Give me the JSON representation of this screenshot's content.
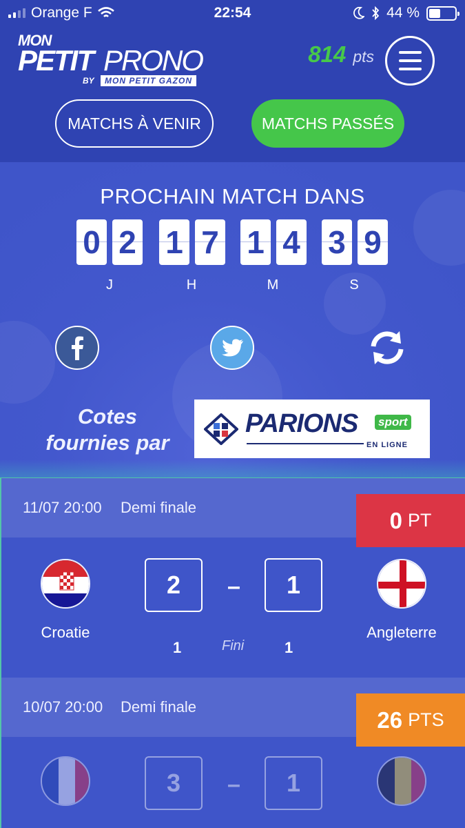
{
  "status_bar": {
    "carrier": "Orange F",
    "time": "22:54",
    "battery": "44 %"
  },
  "header": {
    "logo": {
      "mon": "MON",
      "petit": "PETIT",
      "prono": "PRONO",
      "by": "BY",
      "gazon": "MON PETIT GAZON"
    },
    "points_value": "814",
    "points_unit": "pts",
    "tab_upcoming": "MATCHS À VENIR",
    "tab_past": "MATCHS PASSÉS"
  },
  "countdown": {
    "title": "PROCHAIN MATCH DANS",
    "digits": [
      "0",
      "2",
      "1",
      "7",
      "1",
      "4",
      "3",
      "9"
    ],
    "labels": [
      "J",
      "H",
      "M",
      "S"
    ]
  },
  "sponsor": {
    "text_line1": "Cotes",
    "text_line2": "fournies par",
    "logo_word": "PARIONS",
    "logo_sport": "sport",
    "logo_ligne": "EN LIGNE"
  },
  "matches": [
    {
      "date": "11/07 20:00",
      "round": "Demi finale",
      "points_value": "0",
      "points_unit": "PT",
      "badge_color": "#dc3545",
      "home": "Croatie",
      "away": "Angleterre",
      "home_score": "2",
      "away_score": "1",
      "separator": "–",
      "home_half": "1",
      "away_half": "1",
      "status": "Fini"
    },
    {
      "date": "10/07 20:00",
      "round": "Demi finale",
      "points_value": "26",
      "points_unit": "PTS",
      "badge_color": "#f08a25",
      "home_score": "3",
      "away_score": "1",
      "separator": "–"
    }
  ],
  "colors": {
    "header_bg": "#2f43b2",
    "body_bg": "#3f55c9",
    "accent_green": "#45c64a",
    "points_green": "#47c84a"
  }
}
